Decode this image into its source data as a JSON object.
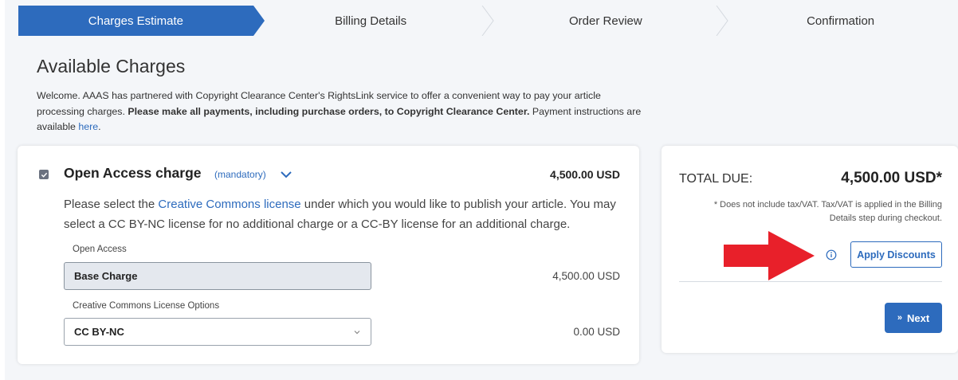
{
  "stepper": {
    "steps": [
      {
        "label": "Charges Estimate"
      },
      {
        "label": "Billing Details"
      },
      {
        "label": "Order Review"
      },
      {
        "label": "Confirmation"
      }
    ]
  },
  "page": {
    "title": "Available Charges",
    "intro_1": "Welcome. AAAS has partnered with Copyright Clearance Center's RightsLink service to offer a convenient way to pay your article processing charges. ",
    "intro_bold": "Please make all payments, including purchase orders, to Copyright Clearance Center.",
    "intro_2": " Payment instructions are available ",
    "intro_link": "here",
    "intro_end": "."
  },
  "charge": {
    "title": "Open Access charge",
    "mandatory": "(mandatory)",
    "price": "4,500.00 USD",
    "desc_1": "Please select the ",
    "desc_link": "Creative Commons license",
    "desc_2": " under which you would like to publish your article. You may select a CC BY-NC license for no additional charge or a CC-BY license for an additional charge.",
    "open_access_label": "Open Access",
    "base_charge_value": "Base Charge",
    "base_charge_price": "4,500.00 USD",
    "license_label": "Creative Commons License Options",
    "license_selected": "CC BY-NC",
    "license_price": "0.00 USD"
  },
  "summary": {
    "total_label": "TOTAL DUE:",
    "total_value": "4,500.00 USD*",
    "tax_note": "* Does not include tax/VAT. Tax/VAT is applied in the Billing Details step during checkout.",
    "apply_discounts": "Apply Discounts",
    "next": "Next",
    "next_glyph": "»"
  },
  "colors": {
    "accent": "#2d6bbd",
    "arrow": "#e8202a"
  }
}
